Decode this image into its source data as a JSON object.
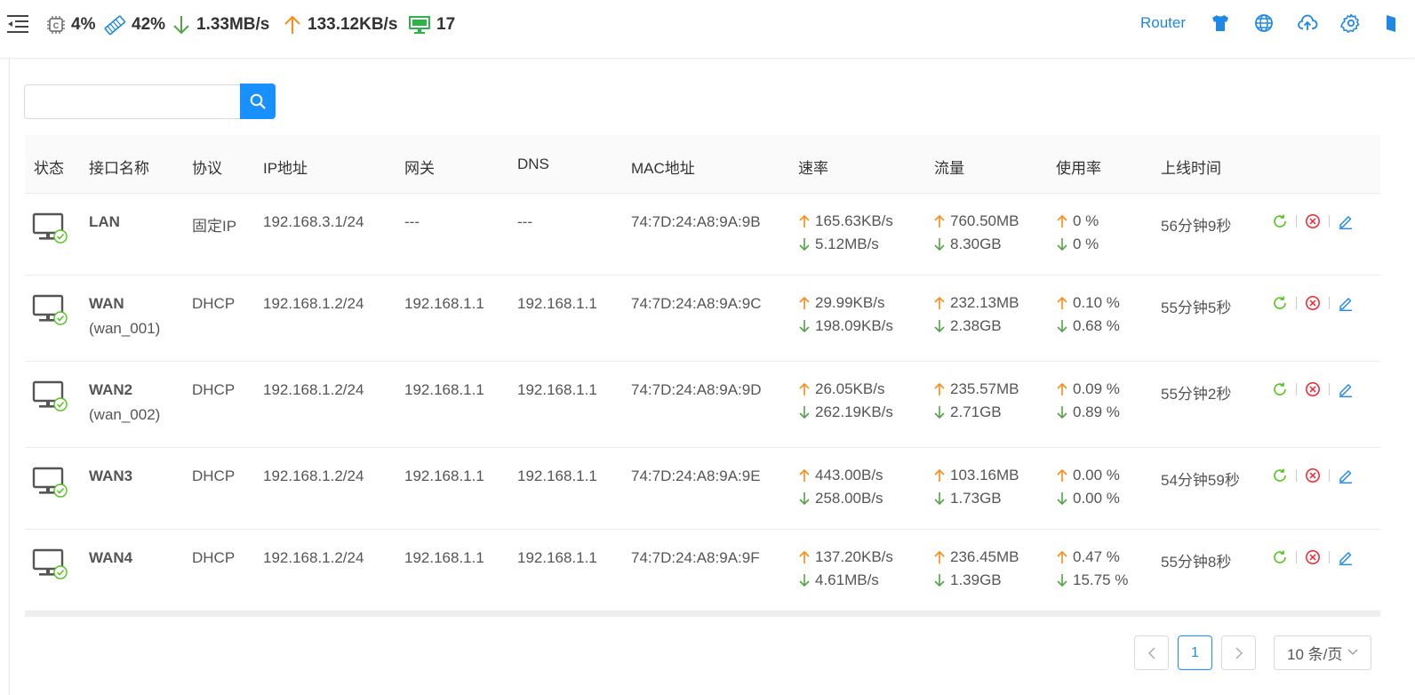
{
  "topbar": {
    "cpu": "4%",
    "mem": "42%",
    "download": "1.33MB/s",
    "upload": "133.12KB/s",
    "clients": "17",
    "router_label": "Router"
  },
  "colors": {
    "accent": "#1890ff",
    "link": "#1e88e5",
    "up": "#fa8c16",
    "down": "#52a447",
    "green": "#52c41a",
    "red": "#f5222d"
  },
  "search": {
    "value": "",
    "placeholder": ""
  },
  "table": {
    "headers": {
      "status": "状态",
      "name": "接口名称",
      "proto": "协议",
      "ip": "IP地址",
      "gateway": "网关",
      "dns": "DNS",
      "mac": "MAC地址",
      "rate": "速率",
      "traffic": "流量",
      "usage": "使用率",
      "uptime": "上线时间"
    },
    "rows": [
      {
        "name": "LAN",
        "alias": "",
        "proto": "固定IP",
        "ip": "192.168.3.1/24",
        "gateway": "---",
        "dns": "---",
        "mac": "74:7D:24:A8:9A:9B",
        "rate_up": "165.63KB/s",
        "rate_down": "5.12MB/s",
        "traffic_up": "760.50MB",
        "traffic_down": "8.30GB",
        "usage_up": "0 %",
        "usage_down": "0 %",
        "uptime": "56分钟9秒"
      },
      {
        "name": "WAN",
        "alias": "(wan_001)",
        "proto": "DHCP",
        "ip": "192.168.1.2/24",
        "gateway": "192.168.1.1",
        "dns": "192.168.1.1",
        "mac": "74:7D:24:A8:9A:9C",
        "rate_up": "29.99KB/s",
        "rate_down": "198.09KB/s",
        "traffic_up": "232.13MB",
        "traffic_down": "2.38GB",
        "usage_up": "0.10 %",
        "usage_down": "0.68 %",
        "uptime": "55分钟5秒"
      },
      {
        "name": "WAN2",
        "alias": "(wan_002)",
        "proto": "DHCP",
        "ip": "192.168.1.2/24",
        "gateway": "192.168.1.1",
        "dns": "192.168.1.1",
        "mac": "74:7D:24:A8:9A:9D",
        "rate_up": "26.05KB/s",
        "rate_down": "262.19KB/s",
        "traffic_up": "235.57MB",
        "traffic_down": "2.71GB",
        "usage_up": "0.09 %",
        "usage_down": "0.89 %",
        "uptime": "55分钟2秒"
      },
      {
        "name": "WAN3",
        "alias": "",
        "proto": "DHCP",
        "ip": "192.168.1.2/24",
        "gateway": "192.168.1.1",
        "dns": "192.168.1.1",
        "mac": "74:7D:24:A8:9A:9E",
        "rate_up": "443.00B/s",
        "rate_down": "258.00B/s",
        "traffic_up": "103.16MB",
        "traffic_down": "1.73GB",
        "usage_up": "0.00 %",
        "usage_down": "0.00 %",
        "uptime": "54分钟59秒"
      },
      {
        "name": "WAN4",
        "alias": "",
        "proto": "DHCP",
        "ip": "192.168.1.2/24",
        "gateway": "192.168.1.1",
        "dns": "192.168.1.1",
        "mac": "74:7D:24:A8:9A:9F",
        "rate_up": "137.20KB/s",
        "rate_down": "4.61MB/s",
        "traffic_up": "236.45MB",
        "traffic_down": "1.39GB",
        "usage_up": "0.47 %",
        "usage_down": "15.75 %",
        "uptime": "55分钟8秒"
      }
    ]
  },
  "pagination": {
    "prev": "<",
    "page": "1",
    "next": ">",
    "page_size": "10 条/页"
  }
}
